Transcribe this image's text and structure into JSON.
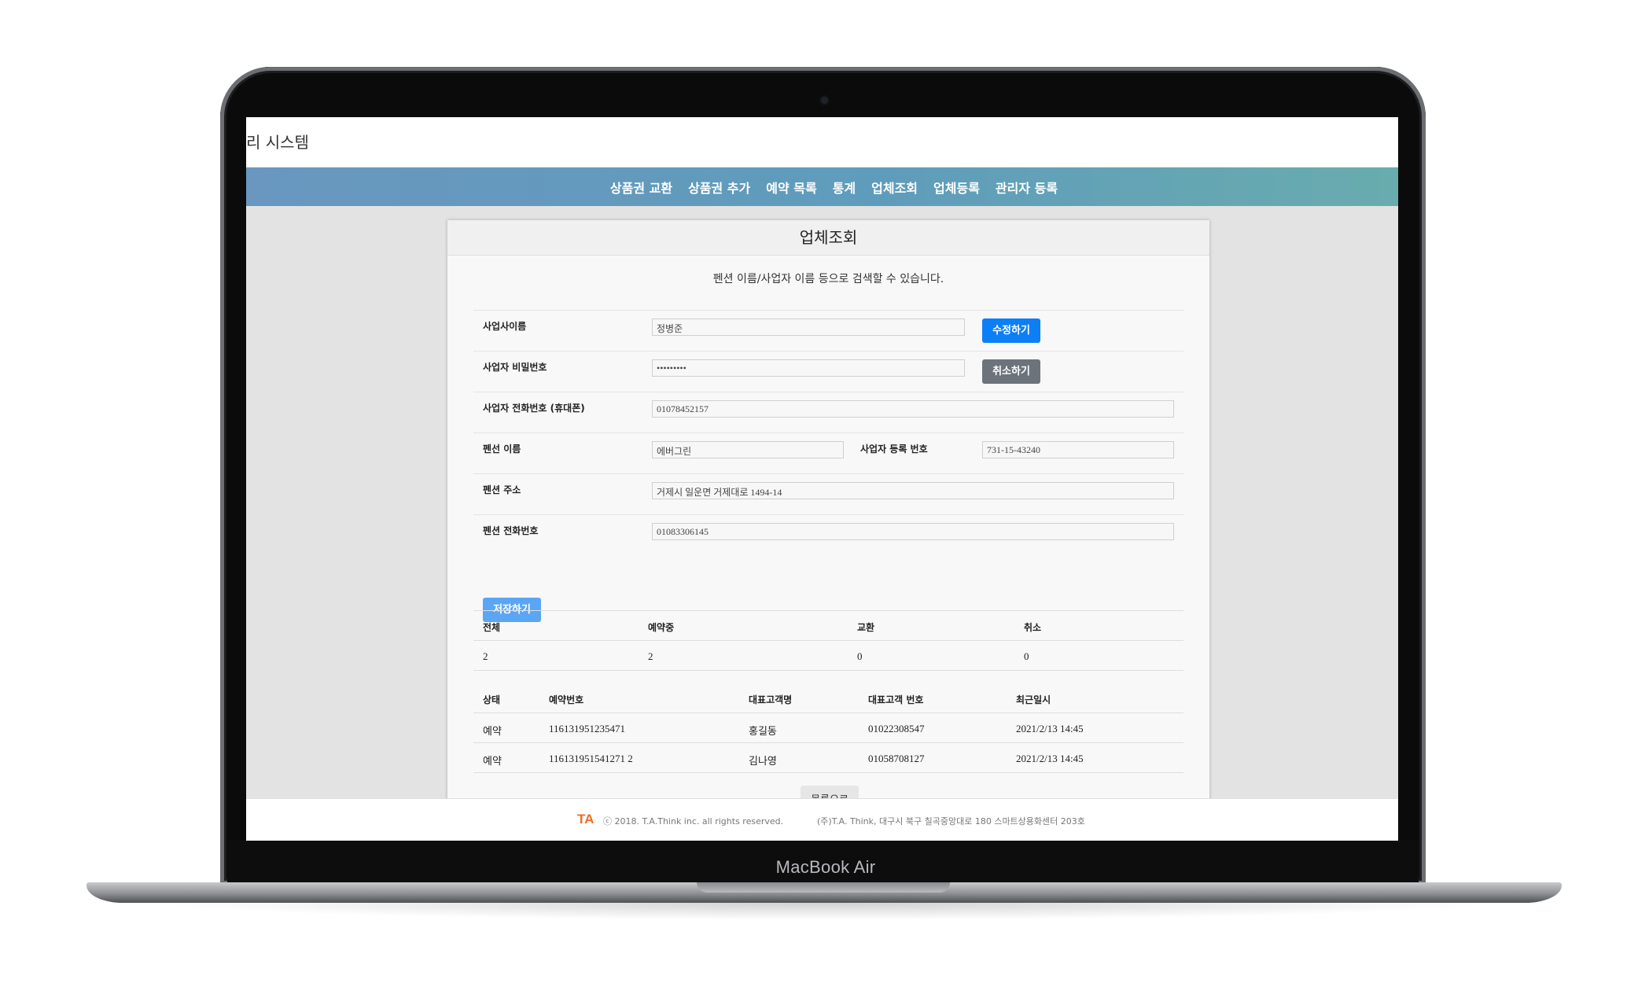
{
  "device": {
    "name": "MacBook Air"
  },
  "app": {
    "title": "리 시스템"
  },
  "nav": {
    "items": [
      {
        "label": "상품권 교환"
      },
      {
        "label": "상품권 추가"
      },
      {
        "label": "예약 목록"
      },
      {
        "label": "통계"
      },
      {
        "label": "업체조회"
      },
      {
        "label": "업체등록"
      },
      {
        "label": "관리자 등록"
      }
    ]
  },
  "card": {
    "title": "업체조회",
    "description": "펜션 이름/사업자 이름 등으로 검색할 수 있습니다."
  },
  "form": {
    "owner_name_label": "사업사이름",
    "owner_name_value": "정병준",
    "password_label": "사업자 비밀번호",
    "password_value": "•••••••••",
    "phone_label": "사업자 전화번호 (휴대폰)",
    "phone_value": "01078452157",
    "pension_name_label": "펜선 이름",
    "pension_name_value": "에버그린",
    "reg_no_label": "사업자 등록 번호",
    "reg_no_value": "731-15-43240",
    "address_label": "펜션 주소",
    "address_value": "거제시 일운면 거제대로 1494-14",
    "pension_phone_label": "펜션 전화번호",
    "pension_phone_value": "01083306145",
    "edit_button": "수정하기",
    "cancel_button": "취소하기",
    "save_button": "저장하기"
  },
  "stats": {
    "headers": [
      "전체",
      "예약중",
      "교환",
      "취소"
    ],
    "values": [
      "2",
      "2",
      "0",
      "0"
    ]
  },
  "reservations": {
    "headers": [
      "상태",
      "예약번호",
      "대표고객명",
      "대표고객 번호",
      "최근일시"
    ],
    "rows": [
      [
        "예약",
        "116131951235471",
        "홍길동",
        "01022308547",
        "2021/2/13 14:45"
      ],
      [
        "예약",
        "116131951541271 2",
        "김나영",
        "01058708127",
        "2021/2/13 14:45"
      ]
    ]
  },
  "list_button": "목록으로",
  "footer": {
    "logo": "TA",
    "copyright": "ⓒ 2018. T.A.Think inc. all rights reserved.",
    "address": "(주)T.A. Think, 대구시 북구 칠곡중앙대로 180 스마트상용화센터 203호"
  }
}
